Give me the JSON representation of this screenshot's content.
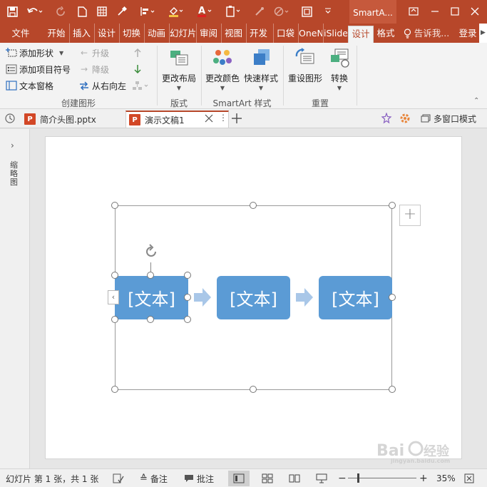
{
  "titlebar": {
    "contextual_title": "SmartA...",
    "accent": "#b7472a"
  },
  "ribbon_tabs": [
    {
      "label": "文件"
    },
    {
      "label": "开始"
    },
    {
      "label": "插入"
    },
    {
      "label": "设计"
    },
    {
      "label": "切换"
    },
    {
      "label": "动画"
    },
    {
      "label": "幻灯片"
    },
    {
      "label": "审阅"
    },
    {
      "label": "视图"
    },
    {
      "label": "开发"
    },
    {
      "label": "口袋"
    },
    {
      "label": "OneN"
    },
    {
      "label": "iSlide"
    },
    {
      "label": "设计",
      "active": true
    },
    {
      "label": "格式"
    },
    {
      "label": "告诉我..."
    },
    {
      "label": "登录"
    }
  ],
  "ribbon": {
    "create_group": {
      "add_shape": "添加形状",
      "add_bullet": "添加项目符号",
      "text_pane": "文本窗格",
      "promote": "升级",
      "demote": "降级",
      "rtl": "从右向左",
      "label": "创建图形"
    },
    "layout_group": {
      "change_layout": "更改布局",
      "label": "版式"
    },
    "styles_group": {
      "change_colors": "更改颜色",
      "quick_styles": "快速样式",
      "label": "SmartArt 样式"
    },
    "reset_group": {
      "reset_graphic": "重设图形",
      "convert": "转换",
      "label": "重置"
    }
  },
  "doc_tabs": {
    "tab1": "简介头图.pptx",
    "tab2": "演示文稿1",
    "multi_window": "多窗口模式"
  },
  "left_pane": {
    "label": "缩略图"
  },
  "smartart": {
    "shape_colors": "#5b9bd5",
    "shapes": [
      {
        "text": "[文本]"
      },
      {
        "text": "[文本]"
      },
      {
        "text": "[文本]"
      }
    ]
  },
  "statusbar": {
    "slide_info": "幻灯片 第 1 张，共 1 张",
    "notes": "备注",
    "comments": "批注",
    "zoom": "35%"
  }
}
